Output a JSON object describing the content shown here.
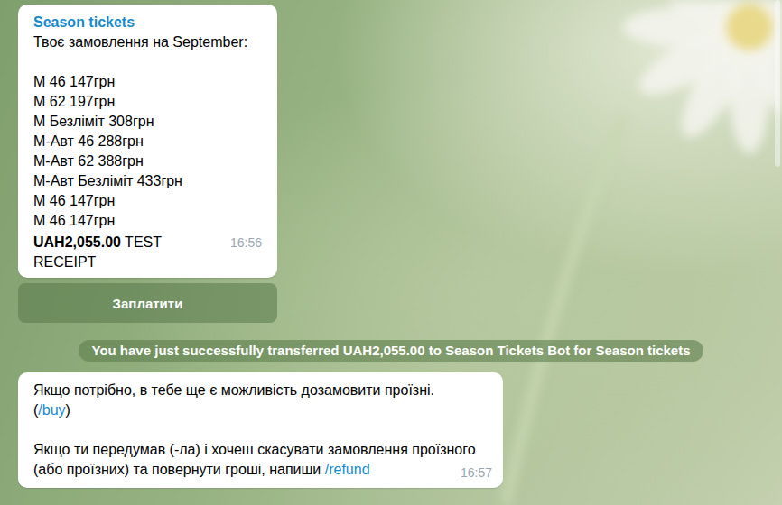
{
  "chat": {
    "invoice": {
      "title": "Season tickets",
      "intro": "Твоє замовлення на September:",
      "items": [
        {
          "name": "М 46",
          "price": "147грн"
        },
        {
          "name": "М 62",
          "price": "197грн"
        },
        {
          "name": "М Безліміт",
          "price": "308грн"
        },
        {
          "name": "М-Авт 46",
          "price": "288грн"
        },
        {
          "name": "М-Авт 62",
          "price": "388грн"
        },
        {
          "name": "М-Авт Безліміт",
          "price": "433грн"
        },
        {
          "name": "М 46",
          "price": "147грн"
        },
        {
          "name": "М 46",
          "price": "147грн"
        }
      ],
      "total": "UAH2,055.00",
      "label": "TEST RECEIPT",
      "time": "16:56"
    },
    "pay_button": {
      "label": "Заплатити"
    },
    "service_message": "You have just successfully transferred UAH2,055.00 to Season Tickets Bot for Season tickets",
    "message": {
      "paragraphs": [
        {
          "lines": [
            [
              {
                "text": "Якщо потрібно, в тебе ще є можливість дозамовити проїзні.",
                "link": false
              }
            ],
            [
              {
                "text": "(",
                "link": false
              },
              {
                "text": "/buy",
                "link": true
              },
              {
                "text": ")",
                "link": false
              }
            ]
          ]
        },
        {
          "lines": [
            [
              {
                "text": "Якщо ти передумав (-ла) і хочеш скасувати замовлення проїзного (або проїзних) та повернути гроші, напиши ",
                "link": false
              },
              {
                "text": "/refund",
                "link": true
              }
            ]
          ]
        }
      ],
      "time": "16:57"
    }
  }
}
